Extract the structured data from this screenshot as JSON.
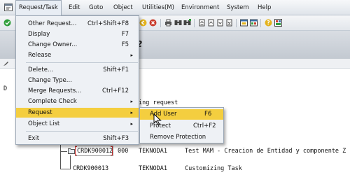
{
  "menubar": {
    "items": [
      {
        "label": "Request/Task",
        "active": true
      },
      {
        "label": "Edit"
      },
      {
        "label": "Goto"
      },
      {
        "label": "Object"
      },
      {
        "label": "Utilities(M)"
      },
      {
        "label": "Environment"
      },
      {
        "label": "System"
      },
      {
        "label": "Help"
      }
    ]
  },
  "toolbar": {
    "icons": [
      "enter-icon",
      "save-icon",
      "back-icon",
      "exit-icon",
      "cancel-icon",
      "print-icon",
      "find-icon",
      "find-next-icon",
      "first-page-icon",
      "prev-page-icon",
      "next-page-icon",
      "last-page-icon",
      "new-session-icon",
      "shortcut-icon",
      "help-icon",
      "layout-icon"
    ],
    "colors": {
      "green": "#2f9e3a",
      "yellow": "#e3b21c",
      "red": "#c93a2b"
    }
  },
  "title": {
    "text": "2"
  },
  "content": {
    "left_char": "D",
    "partial_line": "ing request",
    "rows": [
      {
        "request": "CRDK900012",
        "number": "000",
        "owner": "TEKNODA1",
        "description": "Test MAM - Creacion de Entidad y componente Z"
      },
      {
        "request": "CRDK900013",
        "number": "",
        "owner": "TEKNODA1",
        "description": "Customizing Task"
      }
    ]
  },
  "dropdown": {
    "items": [
      {
        "label": "Other Request...",
        "shortcut": "Ctrl+Shift+F8"
      },
      {
        "label": "Display",
        "shortcut": "F7"
      },
      {
        "label": "Change Owner...",
        "shortcut": "F5"
      },
      {
        "label": "Release",
        "submenu": true
      },
      {
        "label": "Delete...",
        "shortcut": "Shift+F1"
      },
      {
        "label": "Change Type..."
      },
      {
        "label": "Merge Requests...",
        "shortcut": "Ctrl+F12"
      },
      {
        "label": "Complete Check",
        "submenu": true
      },
      {
        "label": "Request",
        "submenu": true,
        "highlighted": true
      },
      {
        "label": "Object List",
        "submenu": true
      },
      {
        "label": "Exit",
        "shortcut": "Shift+F3"
      }
    ]
  },
  "submenu": {
    "items": [
      {
        "label": "Add User",
        "shortcut": "F6",
        "highlighted": true
      },
      {
        "label": "Protect",
        "shortcut": "Ctrl+F2"
      },
      {
        "label": "Remove Protection"
      }
    ]
  },
  "highlight_color": "#f4ce3f"
}
